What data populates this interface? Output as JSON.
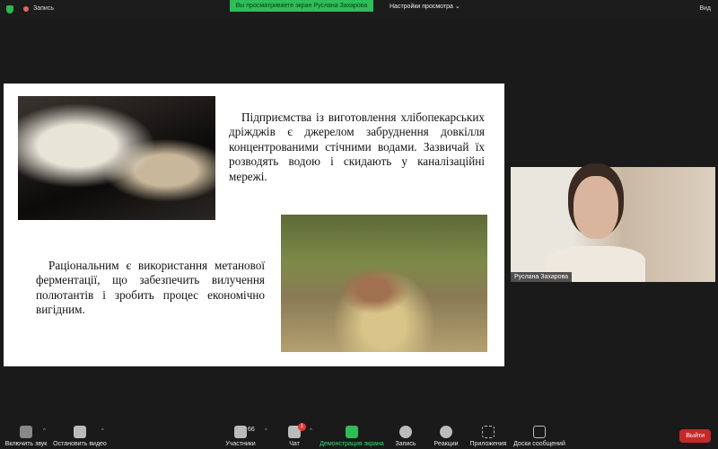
{
  "topbar": {
    "record": "Запись",
    "banner": "Вы просматриваете экран Руслана Захарова",
    "view_settings": "Настройки просмотра ⌄",
    "view": "Вид"
  },
  "slide": {
    "paragraph1": "Підприємства із виготовлення хлібопекарських дріжджів є джерелом забруднення довкілля концентрованими стічними водами. Зазвичай їх розводять водою і скидають у каналізаційні мережі.",
    "paragraph2": "Раціональним є використання метанової ферментації, що забезпечить вилучення полютантів і зробить процес економічно вигідним."
  },
  "video": {
    "name": "Руслана Захарова"
  },
  "toolbar": {
    "unmute": "Включить звук",
    "stop_video": "Остановить видео",
    "participants": "Участники",
    "participants_count": "66",
    "chat": "Чат",
    "chat_badge": "1",
    "share": "Демонстрация экрана",
    "record": "Запись",
    "reactions": "Реакции",
    "apps": "Приложения",
    "whiteboards": "Доски сообщений",
    "leave": "Выйти"
  },
  "colors": {
    "accent": "#2ebd59",
    "leave": "#c62828"
  }
}
